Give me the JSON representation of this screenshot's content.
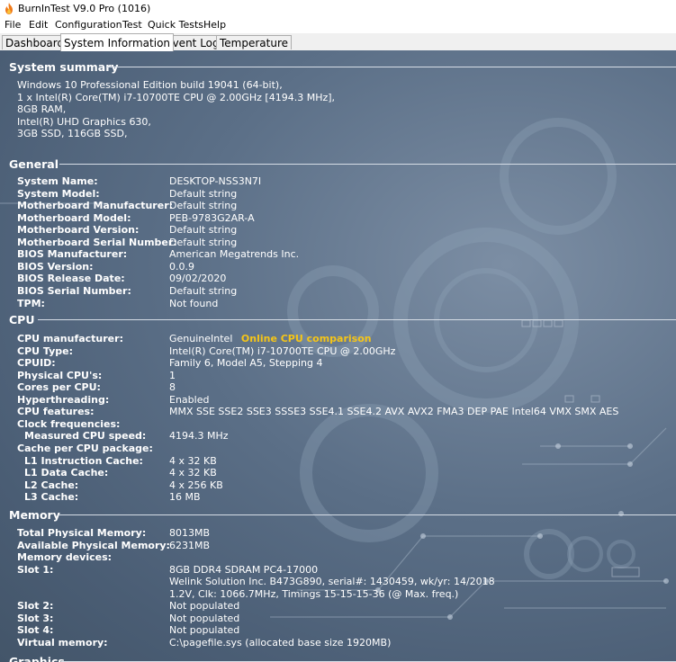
{
  "window": {
    "title": "BurnInTest V9.0 Pro (1016)"
  },
  "menu": [
    "File",
    "Edit",
    "Configuration",
    "Test",
    "Quick Tests",
    "Help"
  ],
  "tabs": [
    {
      "label": "Dashboard",
      "active": false
    },
    {
      "label": "System Information",
      "active": true
    },
    {
      "label": "Event Log",
      "active": false
    },
    {
      "label": "Temperature",
      "active": false
    }
  ],
  "summary": {
    "header": "System summary",
    "lines": [
      "Windows 10 Professional Edition build 19041 (64-bit),",
      "1 x Intel(R) Core(TM) i7-10700TE CPU @ 2.00GHz [4194.3 MHz],",
      "8GB RAM,",
      "Intel(R) UHD Graphics 630,",
      "3GB SSD, 116GB SSD,"
    ]
  },
  "general": {
    "header": "General",
    "rows": [
      {
        "label": "System Name:",
        "value": "DESKTOP-NSS3N7I"
      },
      {
        "label": "System Model:",
        "value": "Default string"
      },
      {
        "label": "Motherboard Manufacturer:",
        "value": "Default string"
      },
      {
        "label": "Motherboard Model:",
        "value": "PEB-9783G2AR-A"
      },
      {
        "label": "Motherboard Version:",
        "value": "Default string"
      },
      {
        "label": "Motherboard Serial Number:",
        "value": "Default string"
      },
      {
        "label": "BIOS Manufacturer:",
        "value": "American Megatrends Inc."
      },
      {
        "label": "BIOS Version:",
        "value": "0.0.9"
      },
      {
        "label": "BIOS Release Date:",
        "value": "09/02/2020"
      },
      {
        "label": "BIOS Serial Number:",
        "value": "Default string"
      },
      {
        "label": "TPM:",
        "value": "Not found"
      }
    ]
  },
  "cpu": {
    "header": "CPU",
    "manufacturer": {
      "label": "CPU manufacturer:",
      "value": "GenuineIntel",
      "link": "Online CPU comparison"
    },
    "rows": [
      {
        "label": "CPU Type:",
        "value": "Intel(R) Core(TM) i7-10700TE CPU @ 2.00GHz"
      },
      {
        "label": "CPUID:",
        "value": "Family 6, Model A5, Stepping 4"
      },
      {
        "label": "Physical CPU's:",
        "value": "1"
      },
      {
        "label": "Cores per CPU:",
        "value": "8"
      },
      {
        "label": "Hyperthreading:",
        "value": "Enabled"
      },
      {
        "label": "CPU features:",
        "value": "MMX SSE SSE2 SSE3 SSSE3 SSE4.1 SSE4.2 AVX AVX2 FMA3 DEP PAE Intel64 VMX SMX AES"
      },
      {
        "label": "Clock frequencies:",
        "value": ""
      }
    ],
    "measured": {
      "label": "Measured CPU speed:",
      "value": "4194.3 MHz"
    },
    "cache_header": {
      "label": "Cache per CPU package:",
      "value": ""
    },
    "cache": [
      {
        "label": "L1 Instruction Cache:",
        "value": "4 x 32 KB"
      },
      {
        "label": "L1 Data Cache:",
        "value": "4 x 32 KB"
      },
      {
        "label": "L2 Cache:",
        "value": "4 x 256 KB"
      },
      {
        "label": "L3 Cache:",
        "value": "16 MB"
      }
    ]
  },
  "memory": {
    "header": "Memory",
    "rows": [
      {
        "label": "Total Physical Memory:",
        "value": "8013MB"
      },
      {
        "label": "Available Physical Memory:",
        "value": "6231MB"
      },
      {
        "label": "Memory devices:",
        "value": ""
      },
      {
        "label": "Slot 1:",
        "value": "8GB DDR4 SDRAM PC4-17000"
      },
      {
        "label": "",
        "value": "Welink Solution Inc. B473G890, serial#: 1430459, wk/yr: 14/2018"
      },
      {
        "label": "",
        "value": "1.2V, Clk: 1066.7MHz, Timings 15-15-15-36 (@ Max. freq.)"
      },
      {
        "label": "Slot 2:",
        "value": "Not populated"
      },
      {
        "label": "Slot 3:",
        "value": "Not populated"
      },
      {
        "label": "Slot 4:",
        "value": "Not populated"
      },
      {
        "label": "Virtual memory:",
        "value": "C:\\pagefile.sys (allocated base size 1920MB)"
      }
    ]
  },
  "graphics": {
    "header": "Graphics"
  },
  "colors": {
    "link": "#f5c518",
    "panel": "#5b6f87",
    "text": "#ffffff"
  }
}
